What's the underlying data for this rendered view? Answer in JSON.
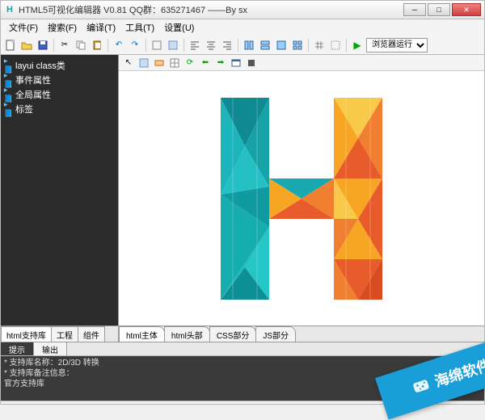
{
  "window": {
    "title": "HTML5可视化编辑器 V0.81 QQ群：635271467 ——By sx"
  },
  "menu": {
    "file": "文件(F)",
    "search": "搜索(F)",
    "compile": "编译(T)",
    "tools": "工具(T)",
    "settings": "设置(U)"
  },
  "toolbar": {
    "run_label": "浏览器运行"
  },
  "tree": {
    "items": [
      {
        "label": "layui class类"
      },
      {
        "label": "事件属性"
      },
      {
        "label": "全局属性"
      },
      {
        "label": "标签"
      }
    ]
  },
  "left_tabs": {
    "items": [
      {
        "label": "html支持库",
        "active": true
      },
      {
        "label": "工程",
        "active": false
      },
      {
        "label": "组件",
        "active": false
      }
    ]
  },
  "right_tabs": {
    "items": [
      {
        "label": "html主体",
        "active": true
      },
      {
        "label": "html头部",
        "active": false
      },
      {
        "label": "CSS部分",
        "active": false
      },
      {
        "label": "JS部分",
        "active": false
      }
    ]
  },
  "console_tabs": {
    "items": [
      {
        "label": "提示",
        "active": true
      },
      {
        "label": "输出",
        "active": false
      }
    ]
  },
  "console": {
    "line1": "* 支持库名称：2D/3D 转换",
    "line2": "* 支持库备注信息：",
    "line3": "官方支持库"
  },
  "watermark": {
    "text": "海绵软件"
  }
}
